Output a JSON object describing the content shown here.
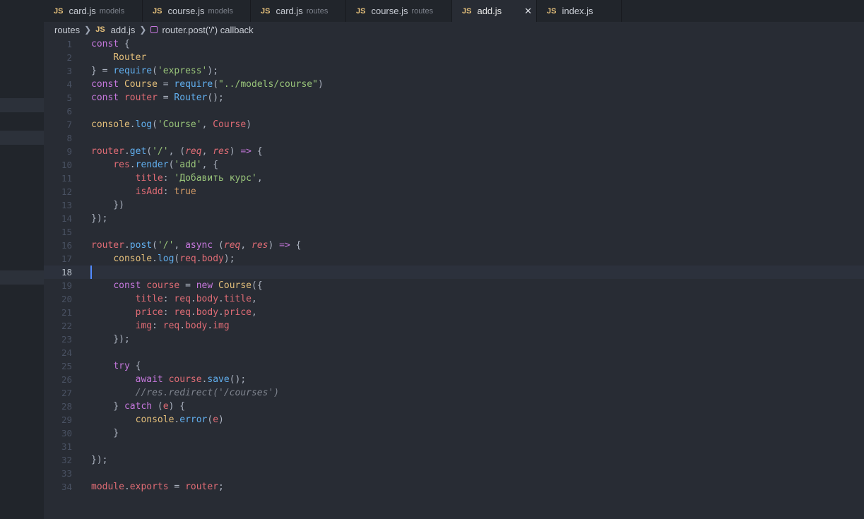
{
  "tabs": [
    {
      "label": "card.js",
      "desc": "models",
      "active": false
    },
    {
      "label": "course.js",
      "desc": "models",
      "active": false
    },
    {
      "label": "card.js",
      "desc": "routes",
      "active": false
    },
    {
      "label": "course.js",
      "desc": "routes",
      "active": false
    },
    {
      "label": "add.js",
      "desc": "",
      "active": true,
      "close": "✕"
    },
    {
      "label": "index.js",
      "desc": "",
      "active": false
    }
  ],
  "file_icon_label": "JS",
  "breadcrumb": {
    "folder": "routes",
    "file": "add.js",
    "symbol": "router.post('/') callback"
  },
  "editor": {
    "current_line": 18,
    "lines": [
      [
        [
          "kw",
          "const"
        ],
        [
          "p",
          " {"
        ]
      ],
      [
        [
          "p",
          "    "
        ],
        [
          "cls",
          "Router"
        ]
      ],
      [
        [
          "p",
          "} = "
        ],
        [
          "fn",
          "require"
        ],
        [
          "p",
          "("
        ],
        [
          "str",
          "'express'"
        ],
        [
          "p",
          ");"
        ]
      ],
      [
        [
          "kw",
          "const"
        ],
        [
          "p",
          " "
        ],
        [
          "cls",
          "Course"
        ],
        [
          "p",
          " = "
        ],
        [
          "fn",
          "require"
        ],
        [
          "p",
          "("
        ],
        [
          "str",
          "\"../models/course\""
        ],
        [
          "p",
          ")"
        ]
      ],
      [
        [
          "kw",
          "const"
        ],
        [
          "p",
          " "
        ],
        [
          "var",
          "router"
        ],
        [
          "p",
          " = "
        ],
        [
          "fn",
          "Router"
        ],
        [
          "p",
          "();"
        ]
      ],
      [],
      [
        [
          "cls",
          "console"
        ],
        [
          "p",
          "."
        ],
        [
          "fn",
          "log"
        ],
        [
          "p",
          "("
        ],
        [
          "str",
          "'Course'"
        ],
        [
          "p",
          ", "
        ],
        [
          "var",
          "Course"
        ],
        [
          "p",
          ")"
        ]
      ],
      [],
      [
        [
          "var",
          "router"
        ],
        [
          "p",
          "."
        ],
        [
          "fn",
          "get"
        ],
        [
          "p",
          "("
        ],
        [
          "str",
          "'/'"
        ],
        [
          "p",
          ", ("
        ],
        [
          "var it",
          "req"
        ],
        [
          "p",
          ", "
        ],
        [
          "var it",
          "res"
        ],
        [
          "p",
          ") "
        ],
        [
          "kw",
          "=>"
        ],
        [
          "p",
          " {"
        ]
      ],
      [
        [
          "p",
          "    "
        ],
        [
          "var",
          "res"
        ],
        [
          "p",
          "."
        ],
        [
          "fn",
          "render"
        ],
        [
          "p",
          "("
        ],
        [
          "str",
          "'add'"
        ],
        [
          "p",
          ", {"
        ]
      ],
      [
        [
          "p",
          "        "
        ],
        [
          "var",
          "title"
        ],
        [
          "p",
          ": "
        ],
        [
          "str",
          "'Добавить курс'"
        ],
        [
          "p",
          ","
        ]
      ],
      [
        [
          "p",
          "        "
        ],
        [
          "var",
          "isAdd"
        ],
        [
          "p",
          ": "
        ],
        [
          "num",
          "true"
        ]
      ],
      [
        [
          "p",
          "    })"
        ]
      ],
      [
        [
          "p",
          "});"
        ]
      ],
      [],
      [
        [
          "var",
          "router"
        ],
        [
          "p",
          "."
        ],
        [
          "fn",
          "post"
        ],
        [
          "p",
          "("
        ],
        [
          "str",
          "'/'"
        ],
        [
          "p",
          ", "
        ],
        [
          "kw",
          "async"
        ],
        [
          "p",
          " ("
        ],
        [
          "var it",
          "req"
        ],
        [
          "p",
          ", "
        ],
        [
          "var it",
          "res"
        ],
        [
          "p",
          ") "
        ],
        [
          "kw",
          "=>"
        ],
        [
          "p",
          " {"
        ]
      ],
      [
        [
          "p",
          "    "
        ],
        [
          "cls",
          "console"
        ],
        [
          "p",
          "."
        ],
        [
          "fn",
          "log"
        ],
        [
          "p",
          "("
        ],
        [
          "var",
          "req"
        ],
        [
          "p",
          "."
        ],
        [
          "var",
          "body"
        ],
        [
          "p",
          ");"
        ]
      ],
      [],
      [
        [
          "p",
          "    "
        ],
        [
          "kw",
          "const"
        ],
        [
          "p",
          " "
        ],
        [
          "var",
          "course"
        ],
        [
          "p",
          " = "
        ],
        [
          "kw",
          "new"
        ],
        [
          "p",
          " "
        ],
        [
          "cls",
          "Course"
        ],
        [
          "p",
          "({"
        ]
      ],
      [
        [
          "p",
          "        "
        ],
        [
          "var",
          "title"
        ],
        [
          "p",
          ": "
        ],
        [
          "var",
          "req"
        ],
        [
          "p",
          "."
        ],
        [
          "var",
          "body"
        ],
        [
          "p",
          "."
        ],
        [
          "var",
          "title"
        ],
        [
          "p",
          ","
        ]
      ],
      [
        [
          "p",
          "        "
        ],
        [
          "var",
          "price"
        ],
        [
          "p",
          ": "
        ],
        [
          "var",
          "req"
        ],
        [
          "p",
          "."
        ],
        [
          "var",
          "body"
        ],
        [
          "p",
          "."
        ],
        [
          "var",
          "price"
        ],
        [
          "p",
          ","
        ]
      ],
      [
        [
          "p",
          "        "
        ],
        [
          "var",
          "img"
        ],
        [
          "p",
          ": "
        ],
        [
          "var",
          "req"
        ],
        [
          "p",
          "."
        ],
        [
          "var",
          "body"
        ],
        [
          "p",
          "."
        ],
        [
          "var",
          "img"
        ]
      ],
      [
        [
          "p",
          "    });"
        ]
      ],
      [],
      [
        [
          "p",
          "    "
        ],
        [
          "kw",
          "try"
        ],
        [
          "p",
          " {"
        ]
      ],
      [
        [
          "p",
          "        "
        ],
        [
          "kw",
          "await"
        ],
        [
          "p",
          " "
        ],
        [
          "var",
          "course"
        ],
        [
          "p",
          "."
        ],
        [
          "fn",
          "save"
        ],
        [
          "p",
          "();"
        ]
      ],
      [
        [
          "p",
          "        "
        ],
        [
          "cm",
          "//res.redirect('/courses')"
        ]
      ],
      [
        [
          "p",
          "    } "
        ],
        [
          "kw",
          "catch"
        ],
        [
          "p",
          " ("
        ],
        [
          "var",
          "e"
        ],
        [
          "p",
          ") {"
        ]
      ],
      [
        [
          "p",
          "        "
        ],
        [
          "cls",
          "console"
        ],
        [
          "p",
          "."
        ],
        [
          "fn",
          "error"
        ],
        [
          "p",
          "("
        ],
        [
          "var",
          "e"
        ],
        [
          "p",
          ")"
        ]
      ],
      [
        [
          "p",
          "    }"
        ]
      ],
      [],
      [
        [
          "p",
          "});"
        ]
      ],
      [],
      [
        [
          "var",
          "module"
        ],
        [
          "p",
          "."
        ],
        [
          "var",
          "exports"
        ],
        [
          "p",
          " = "
        ],
        [
          "var",
          "router"
        ],
        [
          "p",
          ";"
        ]
      ]
    ]
  }
}
